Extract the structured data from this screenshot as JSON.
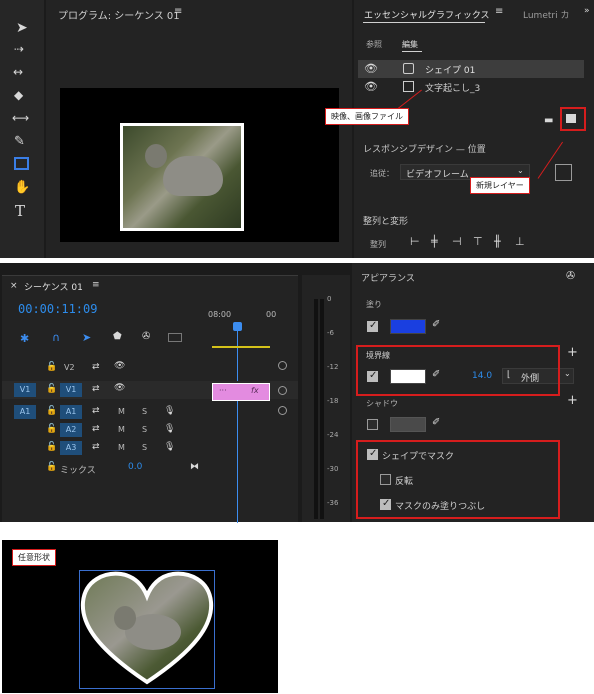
{
  "program_monitor": {
    "title": "プログラム: シーケンス 01"
  },
  "essential_graphics": {
    "tab_active": "エッセンシャルグラフィックス",
    "tab_other": "Lumetri カ",
    "subtab_browse": "参照",
    "subtab_edit": "編集",
    "layers": [
      {
        "label": "シェイプ 01"
      },
      {
        "label": "文字起こし_3"
      }
    ],
    "responsive_label": "レスポンシブデザイン — 位置",
    "pin_label": "追従：",
    "pin_value": "ビデオフレーム",
    "align_label": "整列と変形",
    "align_sub": "整列"
  },
  "callouts": {
    "media": "映像、画像ファイル",
    "new_layer": "新規レイヤー",
    "freeform": "任意形状"
  },
  "timeline": {
    "title": "シーケンス 01",
    "timecode": "00:00:11:09",
    "ruler": [
      "08:00",
      "00"
    ],
    "tracks": [
      {
        "label": "V2"
      },
      {
        "label": "V1",
        "src": "V1"
      },
      {
        "label": "A1",
        "src": "A1",
        "m": "M",
        "s": "S"
      },
      {
        "label": "A2",
        "m": "M",
        "s": "S"
      },
      {
        "label": "A3",
        "m": "M",
        "s": "S"
      }
    ],
    "mix_label": "ミックス",
    "mix_value": "0.0",
    "clip_fx": "fx",
    "clip_dots": "···"
  },
  "meter": {
    "ticks": [
      "0",
      "-6",
      "-12",
      "-18",
      "-24",
      "-30",
      "-36"
    ]
  },
  "appearance": {
    "title": "アピアランス",
    "fill_label": "塗り",
    "fill_color": "#1a3fe0",
    "stroke_label": "境界線",
    "stroke_color": "#ffffff",
    "stroke_width": "14.0",
    "stroke_mode": "外側",
    "shadow_label": "シャドウ",
    "mask_label": "シェイプでマスク",
    "invert_label": "反転",
    "fill_only_label": "マスクのみ塗りつぶし"
  },
  "colors": {
    "accent_blue": "#2d8ceb",
    "highlight_red": "#d61d1d",
    "playhead": "#3c8df0"
  }
}
